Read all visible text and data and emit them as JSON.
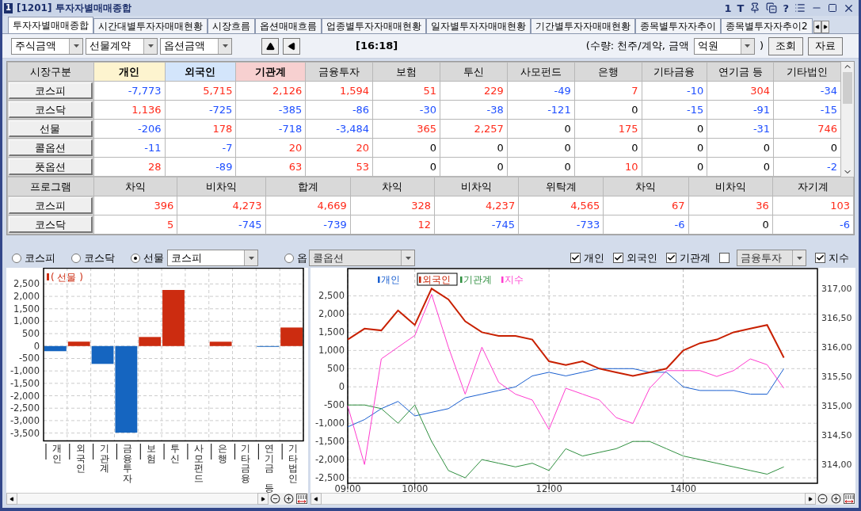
{
  "window": {
    "badge": "1",
    "code": "[1201]",
    "title": "투자자별매매종합",
    "controls": [
      {
        "kind": "glyph",
        "text": "1"
      },
      {
        "kind": "glyph",
        "text": "T"
      },
      {
        "kind": "pin"
      },
      {
        "kind": "restore"
      },
      {
        "kind": "glyph",
        "text": "?"
      },
      {
        "kind": "list"
      },
      {
        "kind": "minimize"
      },
      {
        "kind": "maximize"
      },
      {
        "kind": "close"
      }
    ]
  },
  "tabs": [
    {
      "label": "투자자별매매종합",
      "selected": true
    },
    {
      "label": "시간대별투자자매매현황",
      "selected": false
    },
    {
      "label": "시장흐름",
      "selected": false
    },
    {
      "label": "옵션매매흐름",
      "selected": false
    },
    {
      "label": "업종별투자자매매현황",
      "selected": false
    },
    {
      "label": "일자별투자자매매현황",
      "selected": false
    },
    {
      "label": "기간별투자자매매현황",
      "selected": false
    },
    {
      "label": "종목별투자자추이",
      "selected": false
    },
    {
      "label": "종목별투자자추이2",
      "selected": false
    }
  ],
  "toolbar": {
    "selects": [
      "주식금액",
      "선물계약",
      "옵션금액"
    ],
    "time": "[16:18]",
    "unit_note": "(수량: 천주/계약, 금액",
    "unit_select": "억원",
    "unit_close": ")",
    "buttons": [
      "조회",
      "자료"
    ]
  },
  "investor_table": {
    "corner": "시장구분",
    "columns": [
      {
        "label": "개인",
        "color": "#fdf4cf"
      },
      {
        "label": "외국인",
        "color": "#d3e5fb"
      },
      {
        "label": "기관계",
        "color": "#f7d0d0"
      },
      {
        "label": "금융투자"
      },
      {
        "label": "보험"
      },
      {
        "label": "투신"
      },
      {
        "label": "사모펀드"
      },
      {
        "label": "은행"
      },
      {
        "label": "기타금융"
      },
      {
        "label": "연기금 등"
      },
      {
        "label": "기타법인"
      }
    ],
    "rows": [
      {
        "label": "코스피",
        "cells": [
          {
            "text": "-7,773",
            "color": "#1f4fff"
          },
          {
            "text": "5,715",
            "color": "#ff2a1a"
          },
          {
            "text": "2,126",
            "color": "#ff2a1a"
          },
          {
            "text": "1,594",
            "color": "#ff2a1a"
          },
          {
            "text": "51",
            "color": "#ff2a1a"
          },
          {
            "text": "229",
            "color": "#ff2a1a"
          },
          {
            "text": "-49",
            "color": "#1f4fff"
          },
          {
            "text": "7",
            "color": "#ff2a1a"
          },
          {
            "text": "-10",
            "color": "#1f4fff"
          },
          {
            "text": "304",
            "color": "#ff2a1a"
          },
          {
            "text": "-34",
            "color": "#1f4fff"
          }
        ]
      },
      {
        "label": "코스닥",
        "cells": [
          {
            "text": "1,136",
            "color": "#ff2a1a"
          },
          {
            "text": "-725",
            "color": "#1f4fff"
          },
          {
            "text": "-385",
            "color": "#1f4fff"
          },
          {
            "text": "-86",
            "color": "#1f4fff"
          },
          {
            "text": "-30",
            "color": "#1f4fff"
          },
          {
            "text": "-38",
            "color": "#1f4fff"
          },
          {
            "text": "-121",
            "color": "#1f4fff"
          },
          {
            "text": "0"
          },
          {
            "text": "-15",
            "color": "#1f4fff"
          },
          {
            "text": "-91",
            "color": "#1f4fff"
          },
          {
            "text": "-15",
            "color": "#1f4fff"
          }
        ]
      },
      {
        "label": "선물",
        "cells": [
          {
            "text": "-206",
            "color": "#1f4fff"
          },
          {
            "text": "178",
            "color": "#ff2a1a"
          },
          {
            "text": "-718",
            "color": "#1f4fff"
          },
          {
            "text": "-3,484",
            "color": "#1f4fff"
          },
          {
            "text": "365",
            "color": "#ff2a1a"
          },
          {
            "text": "2,257",
            "color": "#ff2a1a"
          },
          {
            "text": "0"
          },
          {
            "text": "175",
            "color": "#ff2a1a"
          },
          {
            "text": "0"
          },
          {
            "text": "-31",
            "color": "#1f4fff"
          },
          {
            "text": "746",
            "color": "#ff2a1a"
          }
        ]
      },
      {
        "label": "콜옵션",
        "cells": [
          {
            "text": "-11",
            "color": "#1f4fff"
          },
          {
            "text": "-7",
            "color": "#1f4fff"
          },
          {
            "text": "20",
            "color": "#ff2a1a"
          },
          {
            "text": "20",
            "color": "#ff2a1a"
          },
          {
            "text": "0"
          },
          {
            "text": "0"
          },
          {
            "text": "0"
          },
          {
            "text": "0"
          },
          {
            "text": "0"
          },
          {
            "text": "0"
          },
          {
            "text": "0"
          }
        ]
      },
      {
        "label": "풋옵션",
        "cells": [
          {
            "text": "28",
            "color": "#ff2a1a"
          },
          {
            "text": "-89",
            "color": "#1f4fff"
          },
          {
            "text": "63",
            "color": "#ff2a1a"
          },
          {
            "text": "53",
            "color": "#ff2a1a"
          },
          {
            "text": "0"
          },
          {
            "text": "0"
          },
          {
            "text": "0"
          },
          {
            "text": "10",
            "color": "#ff2a1a"
          },
          {
            "text": "0"
          },
          {
            "text": "0"
          },
          {
            "text": "-2",
            "color": "#1f4fff"
          }
        ]
      }
    ]
  },
  "program_table": {
    "corner": "프로그램",
    "columns": [
      "차익",
      "비차익",
      "합계",
      "차익",
      "비차익",
      "위탁계",
      "차익",
      "비차익",
      "자기계"
    ],
    "rows": [
      {
        "label": "코스피",
        "cells": [
          {
            "text": "396",
            "color": "#ff2a1a"
          },
          {
            "text": "4,273",
            "color": "#ff2a1a"
          },
          {
            "text": "4,669",
            "color": "#ff2a1a"
          },
          {
            "text": "328",
            "color": "#ff2a1a"
          },
          {
            "text": "4,237",
            "color": "#ff2a1a"
          },
          {
            "text": "4,565",
            "color": "#ff2a1a"
          },
          {
            "text": "67",
            "color": "#ff2a1a"
          },
          {
            "text": "36",
            "color": "#ff2a1a"
          },
          {
            "text": "103",
            "color": "#ff2a1a"
          }
        ]
      },
      {
        "label": "코스닥",
        "cells": [
          {
            "text": "5",
            "color": "#ff2a1a"
          },
          {
            "text": "-745",
            "color": "#1f4fff"
          },
          {
            "text": "-739",
            "color": "#1f4fff"
          },
          {
            "text": "12",
            "color": "#ff2a1a"
          },
          {
            "text": "-745",
            "color": "#1f4fff"
          },
          {
            "text": "-733",
            "color": "#1f4fff"
          },
          {
            "text": "-6",
            "color": "#1f4fff"
          },
          {
            "text": "0"
          },
          {
            "text": "-6",
            "color": "#1f4fff"
          }
        ]
      }
    ]
  },
  "chart_filters": {
    "markets": [
      {
        "label": "코스피",
        "selected": false
      },
      {
        "label": "코스닥",
        "selected": false
      },
      {
        "label": "선물",
        "selected": true
      }
    ],
    "market_select": {
      "value": "코스피",
      "disabled": false
    },
    "option_radio": {
      "label": "옵",
      "selected": false
    },
    "option_select": {
      "value": "콜옵션",
      "disabled": true
    },
    "series_checks": [
      {
        "label": "개인",
        "checked": true
      },
      {
        "label": "외국인",
        "checked": true
      },
      {
        "label": "기관계",
        "checked": true
      }
    ],
    "extra_check": {
      "checked": false
    },
    "extra_select": {
      "value": "금융투자",
      "disabled": true
    },
    "index_check": {
      "label": "지수",
      "checked": true
    }
  },
  "bar_chart": {
    "chart_data": {
      "type": "bar",
      "grid": true,
      "legend": "upper left",
      "stacked": true,
      "categories": [
        "개인",
        "외국인",
        "기관계",
        "금융투자",
        "보험",
        "투신",
        "사모펀드",
        "은행",
        "기타금융",
        "연기금 등",
        "기타법인"
      ],
      "series": [
        {
          "name": "( 선물 )",
          "color": "#cc2c10",
          "values": [
            null,
            178,
            null,
            null,
            365,
            2257,
            null,
            175,
            null,
            null,
            746
          ]
        },
        {
          "color": "#1565c0",
          "values": [
            -206,
            null,
            -718,
            -3484,
            null,
            null,
            null,
            null,
            null,
            -31,
            null
          ]
        }
      ],
      "ylim": [
        -3800,
        3150
      ],
      "yticks": [
        {
          "value": 2500,
          "label": "2,500"
        },
        {
          "value": 2000,
          "label": "2,000"
        },
        {
          "value": 1500,
          "label": "1,500"
        },
        {
          "value": 1000,
          "label": "1,000"
        },
        {
          "value": 500,
          "label": "500"
        },
        {
          "value": 0,
          "label": "0"
        },
        {
          "value": -500,
          "label": "-500"
        },
        {
          "value": -1000,
          "label": "-1,000"
        },
        {
          "value": -1500,
          "label": "-1,500"
        },
        {
          "value": -2000,
          "label": "-2,000"
        },
        {
          "value": -2500,
          "label": "-2,500"
        },
        {
          "value": -3000,
          "label": "-3,000"
        },
        {
          "value": -3500,
          "label": "-3,500"
        }
      ]
    }
  },
  "line_chart": {
    "legend_entries": [
      {
        "selected": false
      },
      {
        "selected": true
      },
      {
        "selected": false
      },
      {
        "selected": false
      }
    ],
    "chart_data": {
      "type": "line",
      "grid": true,
      "legend": "upper left",
      "x": [
        9,
        9.25,
        9.5,
        9.75,
        10,
        10.25,
        10.5,
        10.75,
        11,
        11.25,
        11.5,
        11.75,
        12,
        12.25,
        12.5,
        12.75,
        13,
        13.25,
        13.5,
        13.75,
        14,
        14.25,
        14.5,
        14.75,
        15,
        15.25,
        15.5
      ],
      "series": [
        {
          "name": "개인",
          "color": "#1a5fd0",
          "values": [
            -1100,
            -900,
            -600,
            -400,
            -800,
            -700,
            -600,
            -300,
            -200,
            -100,
            0,
            300,
            400,
            300,
            400,
            500,
            500,
            500,
            400,
            400,
            0,
            -100,
            -100,
            -100,
            -200,
            -200,
            500
          ]
        },
        {
          "name": "외국인",
          "color": "#c82000",
          "values": [
            1300,
            1600,
            1550,
            2100,
            1700,
            2700,
            2400,
            1800,
            1500,
            1400,
            1400,
            1300,
            700,
            600,
            700,
            500,
            400,
            300,
            400,
            500,
            1000,
            1200,
            1300,
            1500,
            1600,
            1700,
            800
          ]
        },
        {
          "name": "기관계",
          "color": "#2f8f3f",
          "values": [
            -500,
            -500,
            -600,
            -1000,
            -500,
            -1500,
            -2300,
            -2500,
            -2000,
            -2100,
            -2200,
            -2100,
            -2300,
            -1700,
            -1900,
            -1800,
            -1700,
            -1500,
            -1500,
            -1700,
            -1900,
            -2000,
            -2100,
            -2200,
            -2300,
            -2400,
            -2200
          ]
        },
        {
          "name": "지수",
          "color": "#ff3ccf",
          "axis": "y2",
          "values": [
            315,
            314,
            315.8,
            316,
            316.2,
            316.9,
            316,
            315.2,
            316,
            315.4,
            315.2,
            315.1,
            314.6,
            315.3,
            315.2,
            315.1,
            314.8,
            314.7,
            315.3,
            315.6,
            315.6,
            315.6,
            315.5,
            315.6,
            315.8,
            315.7,
            315.3
          ]
        }
      ],
      "xlim": [
        9,
        16
      ],
      "ylim": [
        -2650,
        3250
      ],
      "y2lim": [
        313.68,
        317.34
      ],
      "xticks": [
        {
          "value": 9,
          "label": "09:00"
        },
        {
          "value": 10,
          "label": "10:00"
        },
        {
          "value": 12,
          "label": "12:00"
        },
        {
          "value": 14,
          "label": "14:00"
        }
      ],
      "yticks": [
        {
          "value": 2500,
          "label": "2,500"
        },
        {
          "value": 2000,
          "label": "2,000"
        },
        {
          "value": 1500,
          "label": "1,500"
        },
        {
          "value": 1000,
          "label": "1,000"
        },
        {
          "value": 500,
          "label": "500"
        },
        {
          "value": 0,
          "label": "0"
        },
        {
          "value": -500,
          "label": "-500"
        },
        {
          "value": -1000,
          "label": "-1,000"
        },
        {
          "value": -1500,
          "label": "-1,500"
        },
        {
          "value": -2000,
          "label": "-2,000"
        },
        {
          "value": -2500,
          "label": "-2,500"
        }
      ],
      "y2ticks": [
        {
          "value": 317,
          "label": "317,00"
        },
        {
          "value": 316.5,
          "label": "316,50"
        },
        {
          "value": 316,
          "label": "316,00"
        },
        {
          "value": 315.5,
          "label": "315,50"
        },
        {
          "value": 315,
          "label": "315,00"
        },
        {
          "value": 314.5,
          "label": "314,50"
        },
        {
          "value": 314,
          "label": "314,00"
        }
      ]
    }
  }
}
